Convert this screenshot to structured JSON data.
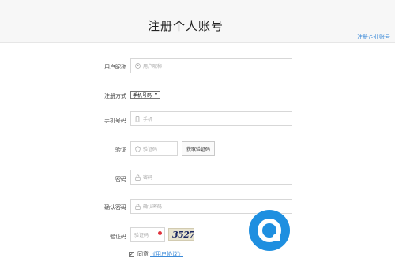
{
  "header": {
    "title": "注册个人账号",
    "corp_link": "注册企业账号"
  },
  "form": {
    "nickname": {
      "label": "用户昵称",
      "placeholder": "用户昵称"
    },
    "method": {
      "label": "注册方式",
      "value": "手机号码"
    },
    "phone": {
      "label": "手机号码",
      "placeholder": "手机"
    },
    "verify": {
      "label": "验证",
      "placeholder": "验证码",
      "button": "获取验证码"
    },
    "password": {
      "label": "密码",
      "placeholder": "密码"
    },
    "confirm": {
      "label": "确认密码",
      "placeholder": "确认密码"
    },
    "captcha": {
      "label": "验证码",
      "placeholder": "验证码",
      "image_text": "3527"
    },
    "agree": {
      "text": "同意",
      "link": "《用户协议》",
      "checked": true
    }
  },
  "colors": {
    "accent": "#3b8ad8",
    "error": "#e0323c",
    "watermark": "#1e8fe0"
  }
}
